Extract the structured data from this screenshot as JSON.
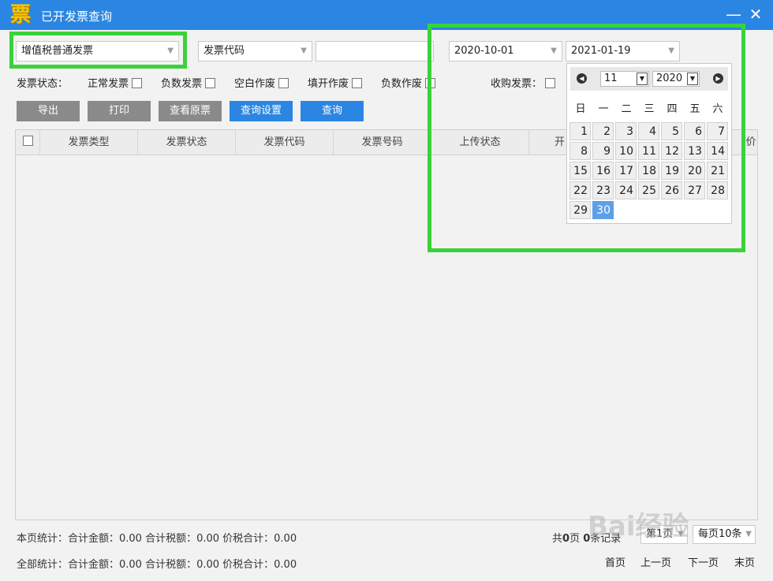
{
  "window": {
    "title": "已开发票查询",
    "logo_glyph": "票",
    "minimize_glyph": "—",
    "close_glyph": "✕"
  },
  "filters": {
    "invoice_type": "增值税普通发票",
    "search_field": "发票代码",
    "search_value": "",
    "date_from": "2020-10-01",
    "date_to": "2021-01-19"
  },
  "status_row": {
    "label": "发票状态：",
    "options": [
      "正常发票",
      "负数发票",
      "空白作废",
      "填开作废",
      "负数作废"
    ],
    "purchase_label": "收购发票："
  },
  "buttons": {
    "export": "导出",
    "print": "打印",
    "view_original": "查看原票",
    "query_settings": "查询设置",
    "query": "查询"
  },
  "table": {
    "columns": [
      "发票类型",
      "发票状态",
      "发票代码",
      "发票号码",
      "上传状态",
      "开",
      "价"
    ]
  },
  "calendar": {
    "month": "11",
    "year": "2020",
    "weekdays": [
      "日",
      "一",
      "二",
      "三",
      "四",
      "五",
      "六"
    ],
    "days": [
      "1",
      "2",
      "3",
      "4",
      "5",
      "6",
      "7",
      "8",
      "9",
      "10",
      "11",
      "12",
      "13",
      "14",
      "15",
      "16",
      "17",
      "18",
      "19",
      "20",
      "21",
      "22",
      "23",
      "24",
      "25",
      "26",
      "27",
      "28",
      "29",
      "30"
    ],
    "selected_day": "30"
  },
  "summary": {
    "page_stats": "本页统计：合计金额：0.00  合计税额：0.00  价税合计：0.00",
    "all_stats": "全部统计：合计金额：0.00  合计税额：0.00  价税合计：0.00"
  },
  "pagination": {
    "total_pages_prefix": "共",
    "total_pages": "0",
    "total_pages_suffix": "页",
    "total_records": "0",
    "total_records_suffix": "条记录",
    "current_page": "第1页",
    "per_page": "每页10条",
    "first": "首页",
    "prev": "上一页",
    "next": "下一页",
    "last": "末页"
  },
  "watermark": "Bai经验",
  "colors": {
    "titlebar": "#2a86e2",
    "highlight": "#3ad23a",
    "selected_day": "#5d9fe8"
  }
}
